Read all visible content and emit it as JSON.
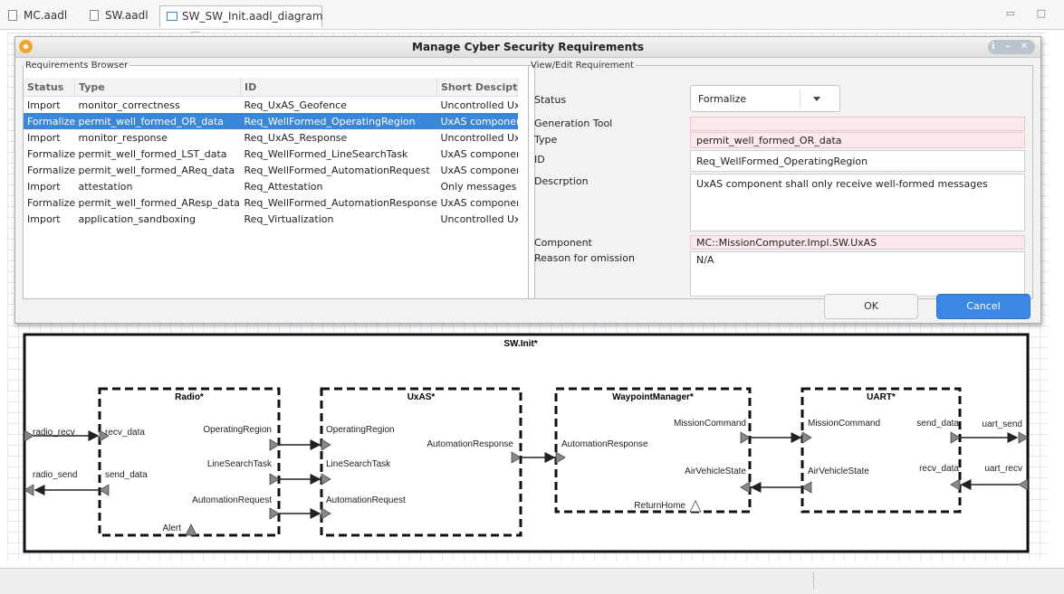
{
  "tabs": [
    {
      "label": "MC.aadl"
    },
    {
      "label": "SW.aadl"
    },
    {
      "label": "SW_SW_Init.aadl_diagram",
      "close": "⌧"
    }
  ],
  "window_controls": "▭ □",
  "dialog": {
    "title": "Manage Cyber Security Requirements",
    "controls": "ℹ – ✕",
    "browser": {
      "legend": "Requirements Browser",
      "columns": [
        "Status",
        "Type",
        "ID",
        "Short Descipt"
      ],
      "rows": [
        [
          "Import",
          "monitor_correctness",
          "Req_UxAS_Geofence",
          "Uncontrolled Ux"
        ],
        [
          "Formalize",
          "permit_well_formed_OR_data",
          "Req_WellFormed_OperatingRegion",
          "UxAS componer"
        ],
        [
          "Import",
          "monitor_response",
          "Req_UxAS_Response",
          "Uncontrolled Ux"
        ],
        [
          "Formalize",
          "permit_well_formed_LST_data",
          "Req_WellFormed_LineSearchTask",
          "UxAS componer"
        ],
        [
          "Formalize",
          "permit_well_formed_AReq_data",
          "Req_WellFormed_AutomationRequest",
          "UxAS componer"
        ],
        [
          "Import",
          "attestation",
          "Req_Attestation",
          "Only messages"
        ],
        [
          "Formalize",
          "permit_well_formed_AResp_data",
          "Req_WellFormed_AutomationResponse",
          "UxAS componer"
        ],
        [
          "Import",
          "application_sandboxing",
          "Req_Virtualization",
          "Uncontrolled Ux"
        ]
      ],
      "selected_row": 1
    },
    "editor": {
      "legend": "View/Edit Requirement",
      "status_label": "Status",
      "status_value": "Formalize",
      "generation_tool_label": "Generation Tool",
      "generation_tool_value": "",
      "type_label": "Type",
      "type_value": "permit_well_formed_OR_data",
      "id_label": "ID",
      "id_value": "Req_WellFormed_OperatingRegion",
      "description_label": "Descrption",
      "description_value": "UxAS component shall only receive well-formed messages",
      "component_label": "Component",
      "component_value": "MC::MissionComputer.Impl.SW.UxAS",
      "reason_label": "Reason for omission",
      "reason_value": "N/A"
    },
    "ok_label": "OK",
    "cancel_label": "Cancel"
  },
  "diagram": {
    "system_label": "SW.Init*",
    "system_ports": [
      "radio_recv",
      "radio_send",
      "uart_send",
      "uart_recv"
    ],
    "components": [
      {
        "name": "Radio*",
        "ports": [
          "recv_data",
          "send_data",
          "OperatingRegion",
          "LineSearchTask",
          "AutomationRequest",
          "Alert"
        ]
      },
      {
        "name": "UxAS*",
        "ports": [
          "OperatingRegion",
          "LineSearchTask",
          "AutomationRequest",
          "AutomationResponse"
        ]
      },
      {
        "name": "WaypointManager*",
        "ports": [
          "AutomationResponse",
          "MissionCommand",
          "AirVehicleState",
          "ReturnHome"
        ]
      },
      {
        "name": "UART*",
        "ports": [
          "MissionCommand",
          "AirVehicleState",
          "send_data",
          "recv_data"
        ]
      }
    ]
  }
}
